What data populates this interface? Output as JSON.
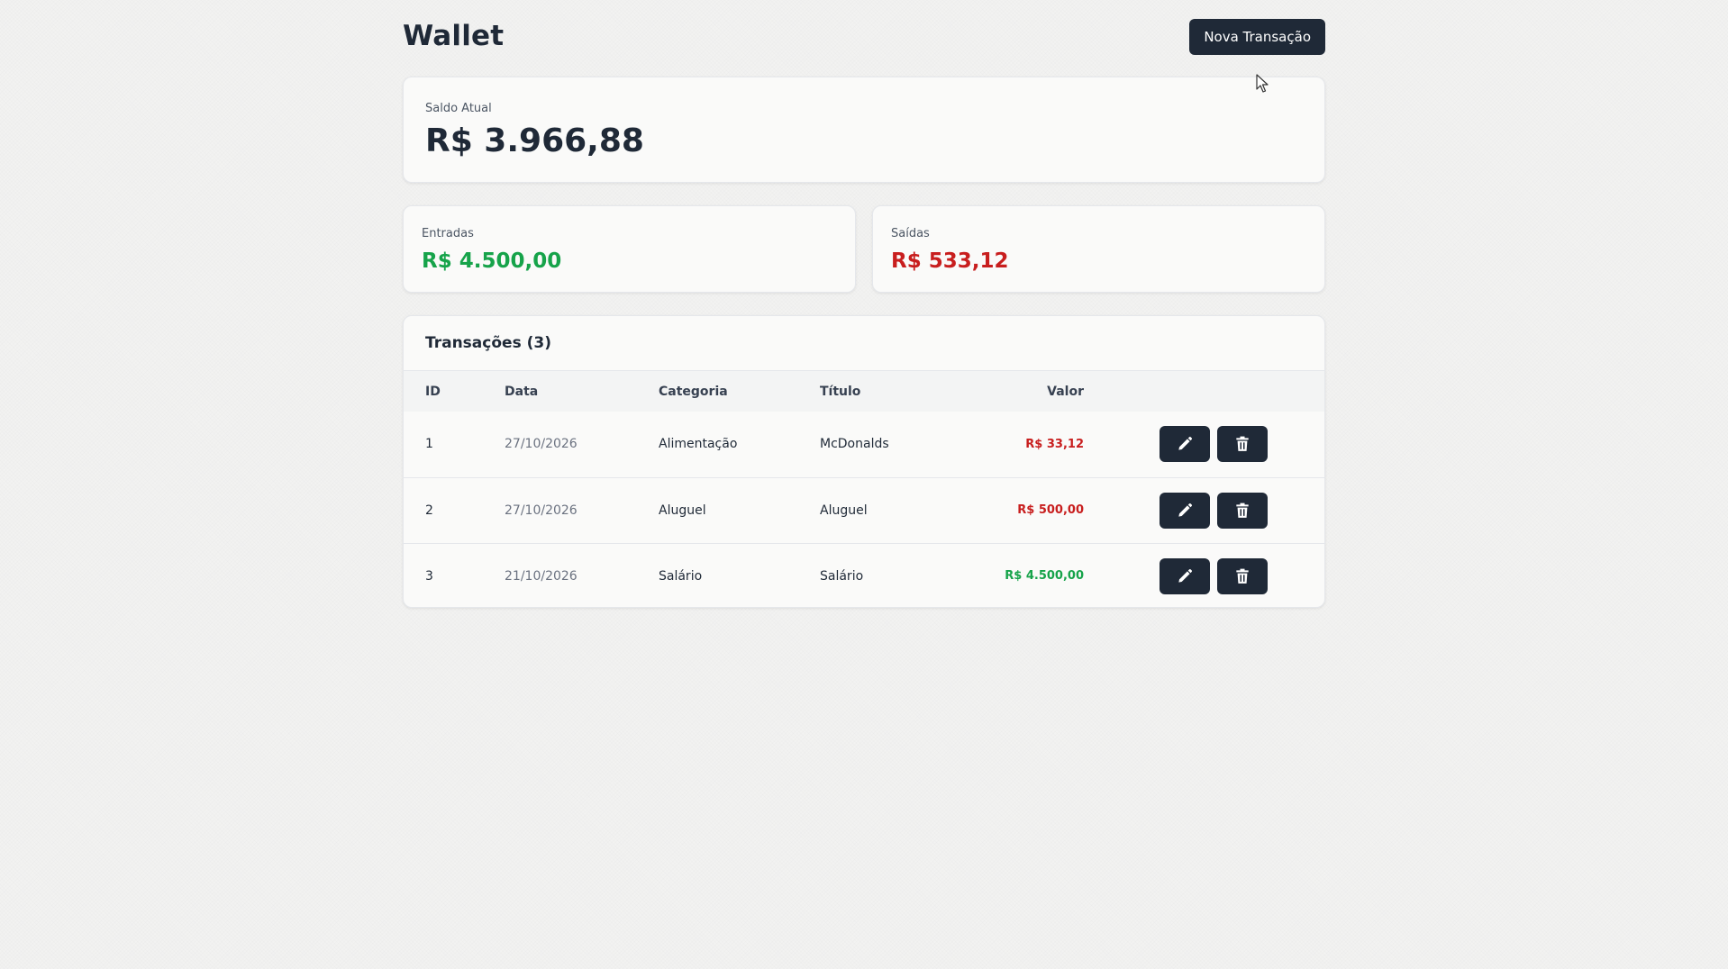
{
  "header": {
    "title": "Wallet",
    "new_button_label": "Nova Transação"
  },
  "balance": {
    "label": "Saldo Atual",
    "value": "R$ 3.966,88"
  },
  "income": {
    "label": "Entradas",
    "value": "R$ 4.500,00",
    "color": "#16a34a"
  },
  "expenses": {
    "label": "Saídas",
    "value": "R$ 533,12",
    "color": "#c81e1e"
  },
  "transactions": {
    "title": "Transações (3)",
    "columns": [
      "ID",
      "Data",
      "Categoria",
      "Título",
      "Valor"
    ],
    "rows": [
      {
        "id": "1",
        "date": "27/10/2026",
        "category": "Alimentação",
        "title": "McDonalds",
        "value": "R$ 33,12",
        "type": "out"
      },
      {
        "id": "2",
        "date": "27/10/2026",
        "category": "Aluguel",
        "title": "Aluguel",
        "value": "R$ 500,00",
        "type": "out"
      },
      {
        "id": "3",
        "date": "21/10/2026",
        "category": "Salário",
        "title": "Salário",
        "value": "R$ 4.500,00",
        "type": "in"
      }
    ]
  },
  "icons": {
    "edit": "pencil-icon",
    "delete": "trash-icon",
    "pointer": "mouse-cursor-icon"
  },
  "colors": {
    "primary": "#1f2937",
    "income": "#16a34a",
    "expense": "#c81e1e",
    "background": "#f2f2f1"
  }
}
